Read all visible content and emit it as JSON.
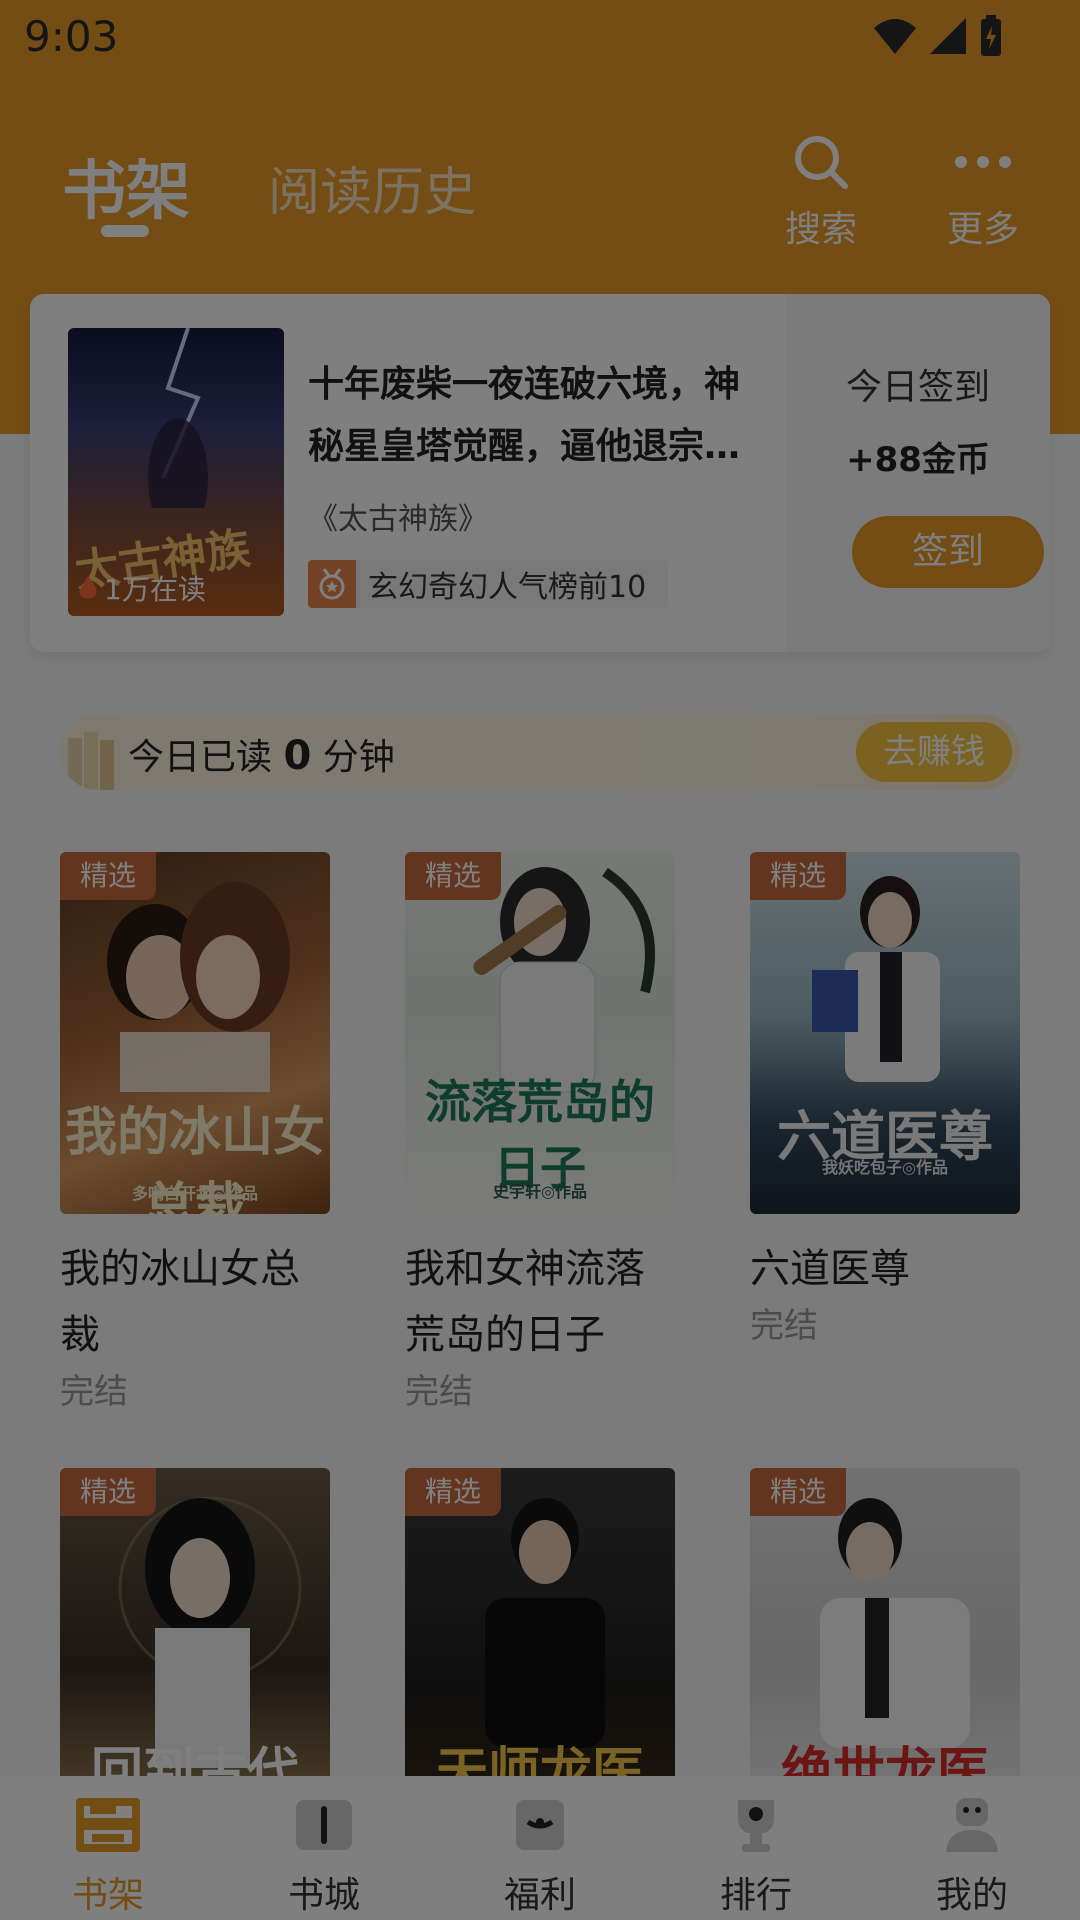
{
  "status_bar": {
    "time": "9:03"
  },
  "header": {
    "tabs": [
      {
        "label": "书架",
        "active": true
      },
      {
        "label": "阅读历史",
        "active": false
      }
    ],
    "actions": [
      {
        "label": "搜索",
        "icon": "search-icon"
      },
      {
        "label": "更多",
        "icon": "more-icon"
      }
    ]
  },
  "checkin_card": {
    "cover_title": "太古神族",
    "readers": "1万在读",
    "headline": "十年废柴一夜连破六境，神秘星皇塔觉醒，逼他退宗…",
    "book_title": "《太古神族》",
    "rank_text": "玄幻奇幻人气榜前10",
    "checkin_title": "今日签到",
    "reward": "+88金币",
    "checkin_button": "签到"
  },
  "reading_bar": {
    "prefix": "今日已读",
    "minutes": "0",
    "suffix": "分钟",
    "earn_button": "去赚钱"
  },
  "books": [
    {
      "tag": "精选",
      "title": "我的冰山女总裁",
      "state": "完结",
      "cover_text": "我的冰山女总裁",
      "author_line": "多喝白开水◎作品"
    },
    {
      "tag": "精选",
      "title": "我和女神流落荒岛的日子",
      "state": "完结",
      "cover_text": "流落荒岛的日子",
      "author_line": "史宇轩◎作品"
    },
    {
      "tag": "精选",
      "title": "六道医尊",
      "state": "完结",
      "cover_text": "六道医尊",
      "author_line": "我妖吃包子◎作品"
    },
    {
      "tag": "精选",
      "title": "",
      "state": "",
      "cover_text": "回到古代",
      "author_line": ""
    },
    {
      "tag": "精选",
      "title": "",
      "state": "",
      "cover_text": "天师龙医",
      "author_line": ""
    },
    {
      "tag": "精选",
      "title": "",
      "state": "",
      "cover_text": "绝世龙医",
      "author_line": ""
    }
  ],
  "bottom_nav": [
    {
      "label": "书架",
      "icon": "bookshelf-icon",
      "active": true
    },
    {
      "label": "书城",
      "icon": "bookstore-icon",
      "active": false
    },
    {
      "label": "福利",
      "icon": "gift-icon",
      "active": false
    },
    {
      "label": "排行",
      "icon": "trophy-icon",
      "active": false
    },
    {
      "label": "我的",
      "icon": "profile-icon",
      "active": false
    }
  ],
  "colors": {
    "accent": "#e89a2a",
    "tag": "#c96a3c",
    "muted": "#999999"
  }
}
